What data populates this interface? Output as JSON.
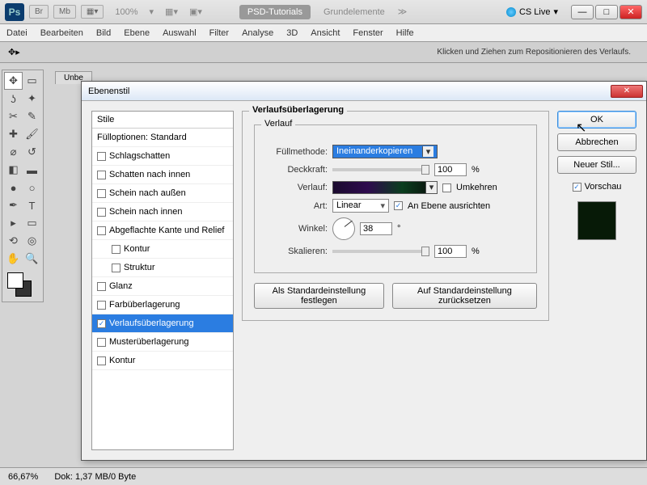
{
  "topbar": {
    "logo": "Ps",
    "br": "Br",
    "mb": "Mb",
    "zoom": "100%",
    "tab1": "PSD-Tutorials",
    "tab2": "Grundelemente",
    "cslive": "CS Live"
  },
  "menu": [
    "Datei",
    "Bearbeiten",
    "Bild",
    "Ebene",
    "Auswahl",
    "Filter",
    "Analyse",
    "3D",
    "Ansicht",
    "Fenster",
    "Hilfe"
  ],
  "opts": {
    "hint": "Klicken und Ziehen zum Repositionieren des Verlaufs."
  },
  "doc": {
    "tab": "Unbe"
  },
  "dialog": {
    "title": "Ebenenstil",
    "styles_header": "Stile",
    "fill_opts": "Fülloptionen: Standard",
    "items": [
      {
        "label": "Schlagschatten",
        "checked": false
      },
      {
        "label": "Schatten nach innen",
        "checked": false
      },
      {
        "label": "Schein nach außen",
        "checked": false
      },
      {
        "label": "Schein nach innen",
        "checked": false
      },
      {
        "label": "Abgeflachte Kante und Relief",
        "checked": false
      },
      {
        "label": "Kontur",
        "checked": false,
        "sub": true
      },
      {
        "label": "Struktur",
        "checked": false,
        "sub": true
      },
      {
        "label": "Glanz",
        "checked": false
      },
      {
        "label": "Farbüberlagerung",
        "checked": false
      },
      {
        "label": "Verlaufsüberlagerung",
        "checked": true,
        "selected": true
      },
      {
        "label": "Musterüberlagerung",
        "checked": false
      },
      {
        "label": "Kontur",
        "checked": false
      }
    ],
    "panel": {
      "group": "Verlaufsüberlagerung",
      "subgroup": "Verlauf",
      "blend_label": "Füllmethode:",
      "blend_value": "Ineinanderkopieren",
      "opacity_label": "Deckkraft:",
      "opacity_value": "100",
      "percent": "%",
      "gradient_label": "Verlauf:",
      "reverse": "Umkehren",
      "style_label": "Art:",
      "style_value": "Linear",
      "align": "An Ebene ausrichten",
      "angle_label": "Winkel:",
      "angle_value": "38",
      "degree": "°",
      "scale_label": "Skalieren:",
      "scale_value": "100",
      "btn_default": "Als Standardeinstellung festlegen",
      "btn_reset": "Auf Standardeinstellung zurücksetzen"
    },
    "buttons": {
      "ok": "OK",
      "cancel": "Abbrechen",
      "new_style": "Neuer Stil...",
      "preview": "Vorschau"
    }
  },
  "status": {
    "zoom": "66,67%",
    "doc": "Dok: 1,37 MB/0 Byte"
  }
}
